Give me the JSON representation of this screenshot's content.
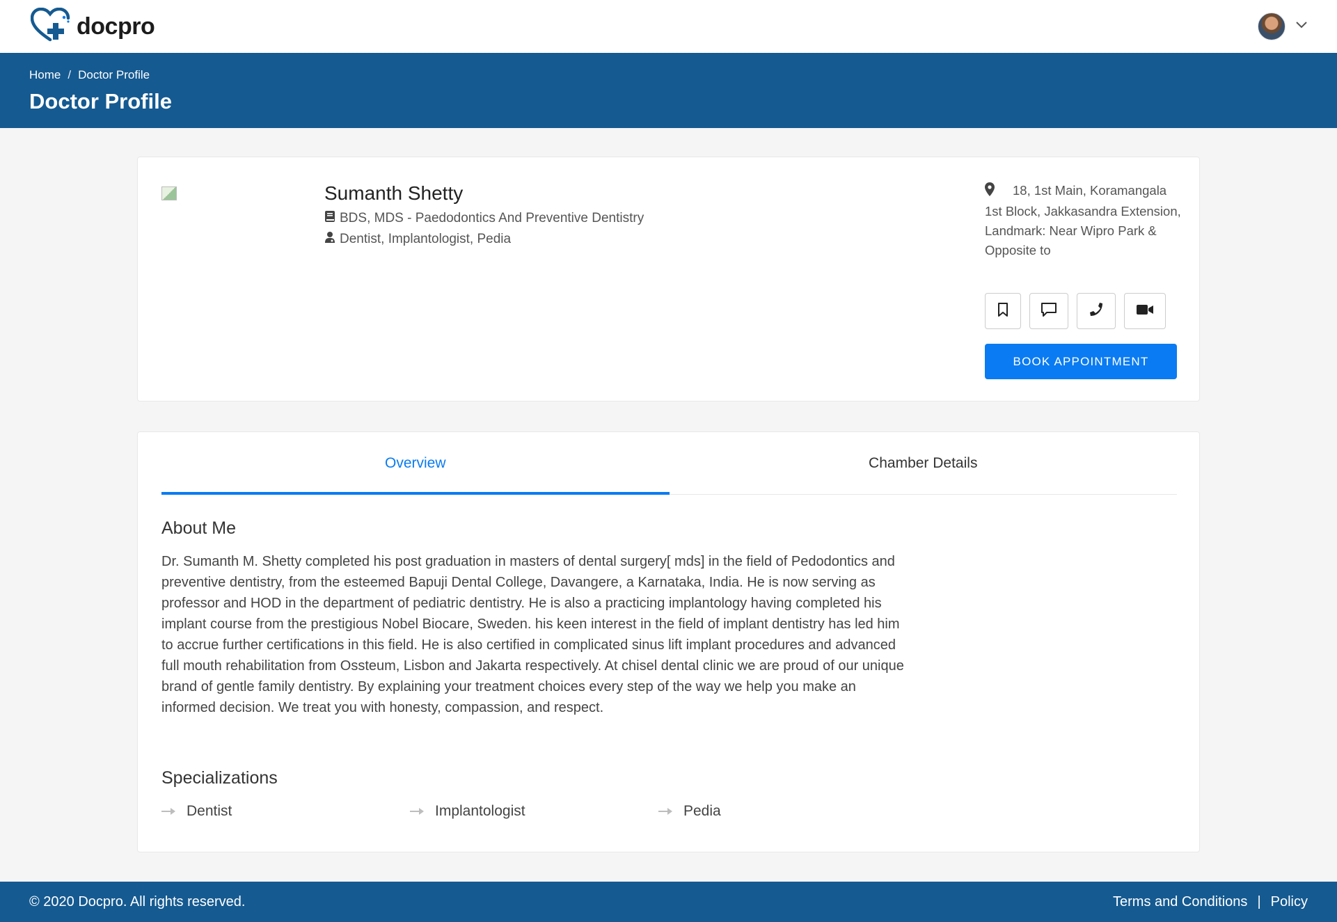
{
  "app": {
    "logo_text": "docpro",
    "brand_color": "#155a91",
    "accent_color": "#0a7bf2"
  },
  "header": {
    "user_avatar": "doctor-avatar",
    "dropdown_icon": "chevron-down-icon"
  },
  "banner": {
    "breadcrumb": [
      "Home",
      "Doctor Profile"
    ],
    "breadcrumb_separator": "/",
    "title": "Doctor Profile"
  },
  "profile": {
    "name": "Sumanth Shetty",
    "qualification": "BDS, MDS - Paedodontics And Preventive Dentistry",
    "specialities": "Dentist, Implantologist, Pedia",
    "address": "18, 1st Main, Koramangala 1st Block, Jakkasandra Extension, Landmark: Near Wipro Park & Opposite to",
    "actions": [
      {
        "icon": "bookmark-icon"
      },
      {
        "icon": "chat-icon"
      },
      {
        "icon": "phone-icon"
      },
      {
        "icon": "video-icon"
      }
    ],
    "book_label": "BOOK APPOINTMENT"
  },
  "tabs": [
    {
      "label": "Overview",
      "active": true
    },
    {
      "label": "Chamber Details",
      "active": false
    }
  ],
  "overview": {
    "about_title": "About Me",
    "about_text": "Dr. Sumanth M. Shetty completed his post graduation in masters of dental surgery[ mds] in the field of Pedodontics and preventive dentistry, from the esteemed Bapuji Dental College, Davangere, a Karnataka, India. He is now serving as professor and HOD in the department of pediatric dentistry. He is also a practicing implantology having completed his implant course from the prestigious Nobel Biocare, Sweden. his keen interest in the field of implant dentistry has led him to accrue further certifications in this field. He is also certified in complicated sinus lift implant procedures and advanced full mouth rehabilitation from Ossteum, Lisbon and Jakarta respectively. At chisel dental clinic we are proud of our unique brand of gentle family dentistry. By explaining your treatment choices every step of the way we help you make an informed decision. We treat you with honesty, compassion, and respect.",
    "specializations_title": "Specializations",
    "specializations": [
      "Dentist",
      "Implantologist",
      "Pedia"
    ]
  },
  "footer": {
    "copyright": "© 2020 Docpro. All rights reserved.",
    "terms": "Terms and Conditions",
    "separator": "|",
    "policy": "Policy"
  }
}
